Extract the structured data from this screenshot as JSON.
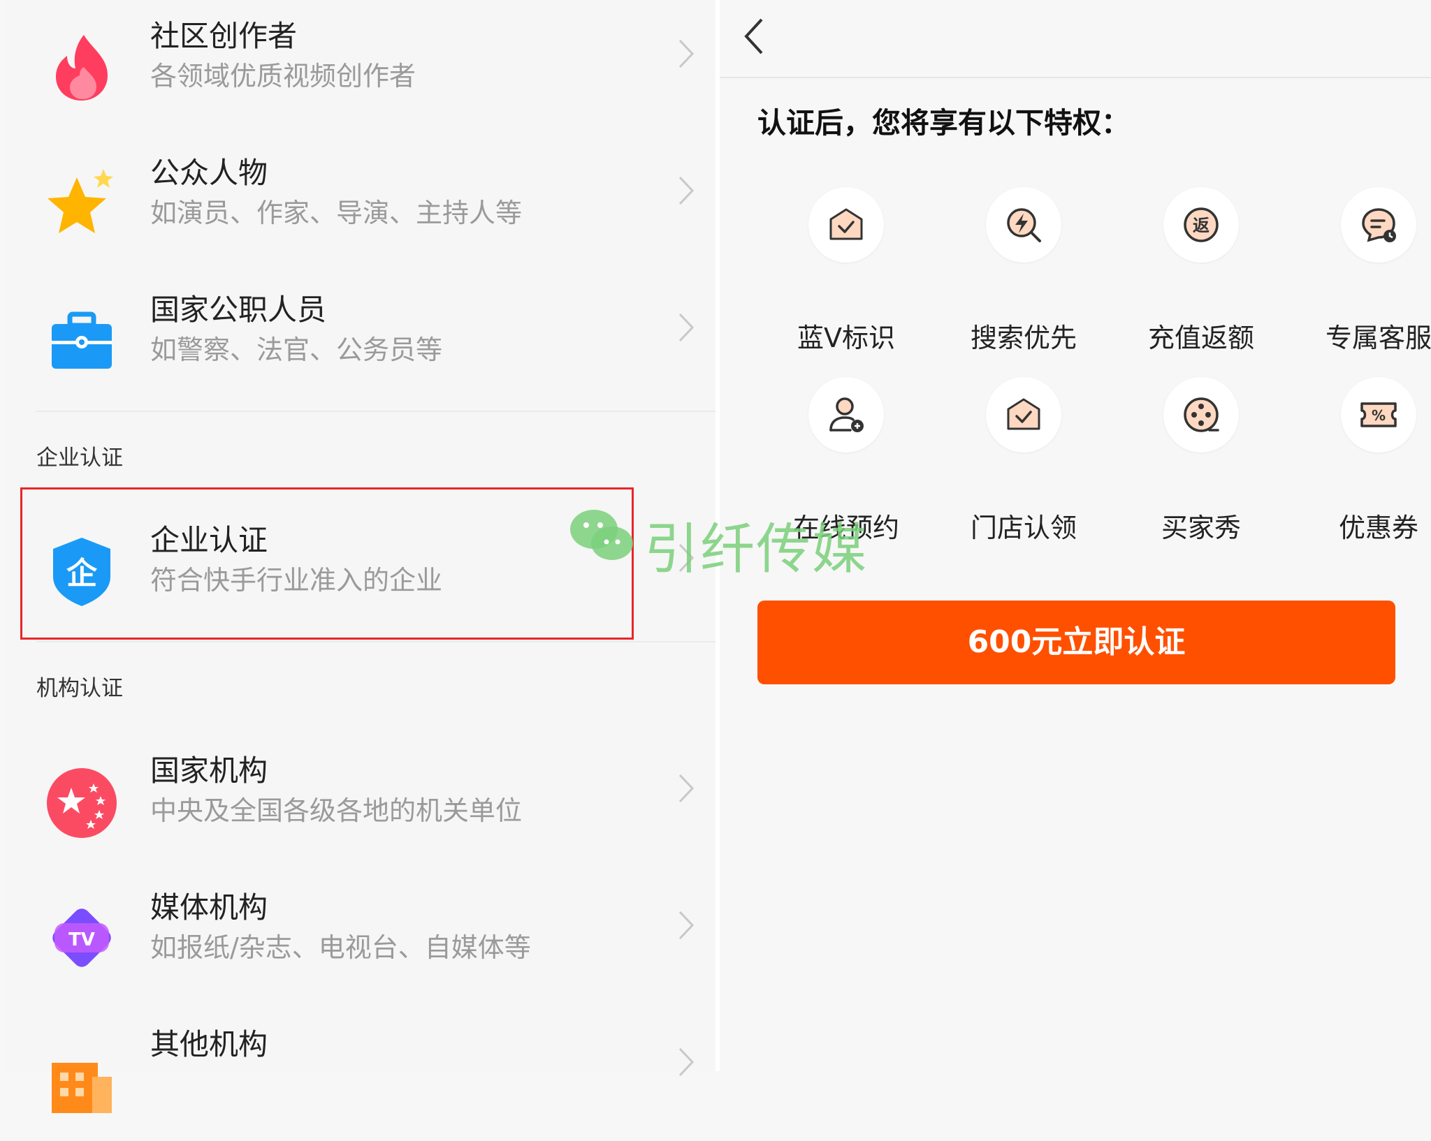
{
  "left": {
    "rows_top": [
      {
        "title": "社区创作者",
        "desc": "各领域优质视频创作者",
        "icon": "flame-icon"
      },
      {
        "title": "公众人物",
        "desc": "如演员、作家、导演、主持人等",
        "icon": "star-icon"
      },
      {
        "title": "国家公职人员",
        "desc": "如警察、法官、公务员等",
        "icon": "briefcase-icon"
      }
    ],
    "section_enterprise": "企业认证",
    "enterprise_row": {
      "title": "企业认证",
      "desc": "符合快手行业准入的企业",
      "badge_char": "企",
      "icon": "enterprise-shield-icon"
    },
    "section_org": "机构认证",
    "rows_org": [
      {
        "title": "国家机构",
        "desc": "中央及全国各级各地的机关单位",
        "icon": "national-stars-icon"
      },
      {
        "title": "媒体机构",
        "desc": "如报纸/杂志、电视台、自媒体等",
        "icon": "tv-icon",
        "badge_char": "TV"
      },
      {
        "title": "其他机构",
        "desc": "",
        "icon": "building-icon"
      }
    ]
  },
  "watermark": {
    "text": "引纤传媒",
    "icon": "wechat-icon"
  },
  "right": {
    "heading": "认证后，您将享有以下特权：",
    "perks": [
      {
        "label": "蓝V标识",
        "icon": "blue-v-badge-icon"
      },
      {
        "label": "搜索优先",
        "icon": "search-priority-icon"
      },
      {
        "label": "充值返额",
        "icon": "cashback-icon",
        "badge_char": "返"
      },
      {
        "label": "专属客服",
        "icon": "customer-service-icon"
      },
      {
        "label": "在线预约",
        "icon": "online-booking-icon"
      },
      {
        "label": "门店认领",
        "icon": "store-claim-icon"
      },
      {
        "label": "买家秀",
        "icon": "buyer-show-icon"
      },
      {
        "label": "优惠券",
        "icon": "coupon-icon",
        "badge_char": "%"
      }
    ],
    "cta_label": "600元立即认证"
  },
  "colors": {
    "accent": "#ff5000",
    "highlight": "#e8262a",
    "blue": "#1a9af6",
    "star": "#ffb400",
    "flame": "#ff3d5e"
  }
}
